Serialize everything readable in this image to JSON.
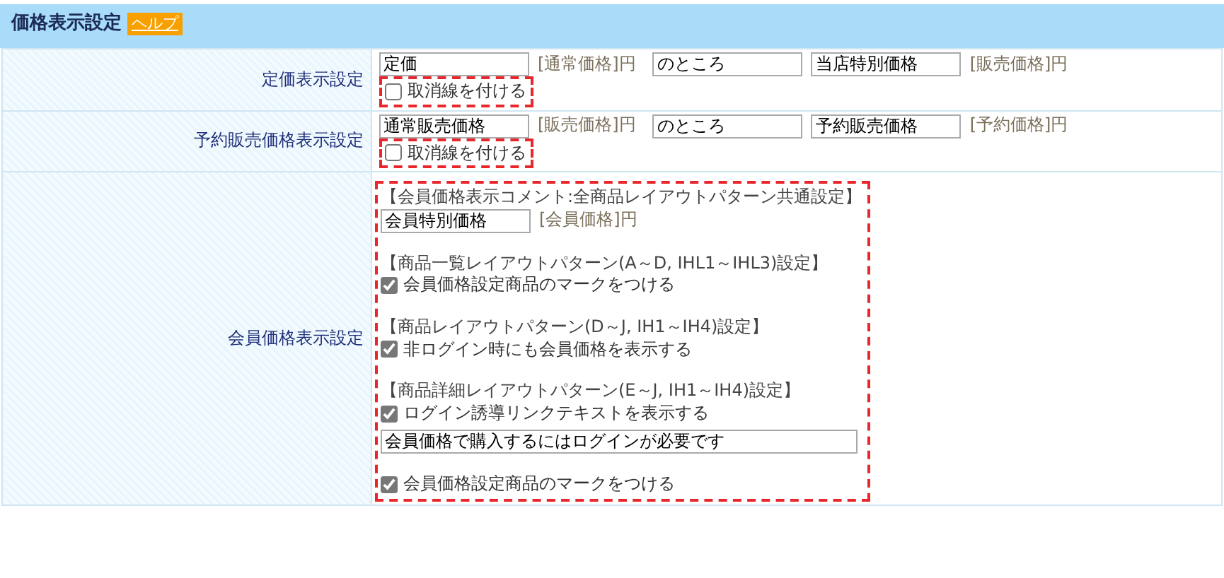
{
  "section": {
    "title": "価格表示設定",
    "help": "ヘルプ"
  },
  "rows": [
    {
      "label": "定価表示設定",
      "items": [
        {
          "kind": "input",
          "value": "定価"
        },
        {
          "kind": "tag",
          "text": "[通常価格]円"
        },
        {
          "kind": "input",
          "value": "のところ"
        },
        {
          "kind": "input",
          "value": "当店特別価格"
        },
        {
          "kind": "tag",
          "text": "[販売価格]円"
        }
      ],
      "options": [
        {
          "label": "取消線を付ける",
          "checked": false
        }
      ]
    },
    {
      "label": "予約販売価格表示設定",
      "items": [
        {
          "kind": "input",
          "value": "通常販売価格"
        },
        {
          "kind": "tag",
          "text": "[販売価格]円"
        },
        {
          "kind": "input",
          "value": "のところ"
        },
        {
          "kind": "input",
          "value": "予約販売価格"
        },
        {
          "kind": "tag",
          "text": "[予約価格]円"
        }
      ],
      "options": [
        {
          "label": "取消線を付ける",
          "checked": false
        }
      ]
    },
    {
      "label": "会員価格表示設定",
      "groups": [
        [
          {
            "kind": "heading",
            "text": "【会員価格表示コメント:全商品レイアウトパターン共通設定】"
          },
          {
            "kind": "inline",
            "items": [
              {
                "kind": "input",
                "value": "会員特別価格"
              },
              {
                "kind": "tag",
                "text": "[会員価格]円"
              }
            ]
          }
        ],
        [
          {
            "kind": "heading",
            "text": "【商品一覧レイアウトパターン(A～D, IHL1～IHL3)設定】"
          },
          {
            "kind": "checkbox",
            "label": "会員価格設定商品のマークをつける",
            "checked": true
          }
        ],
        [
          {
            "kind": "heading",
            "text": "【商品レイアウトパターン(D～J, IH1～IH4)設定】"
          },
          {
            "kind": "checkbox",
            "label": "非ログイン時にも会員価格を表示する",
            "checked": true
          }
        ],
        [
          {
            "kind": "heading",
            "text": "【商品詳細レイアウトパターン(E～J, IH1～IH4)設定】"
          },
          {
            "kind": "checkbox",
            "label": "ログイン誘導リンクテキストを表示する",
            "checked": true
          },
          {
            "kind": "wide-input",
            "value": "会員価格で購入するにはログインが必要です"
          }
        ],
        [
          {
            "kind": "checkbox",
            "label": "会員価格設定商品のマークをつける",
            "checked": true
          }
        ]
      ]
    }
  ]
}
